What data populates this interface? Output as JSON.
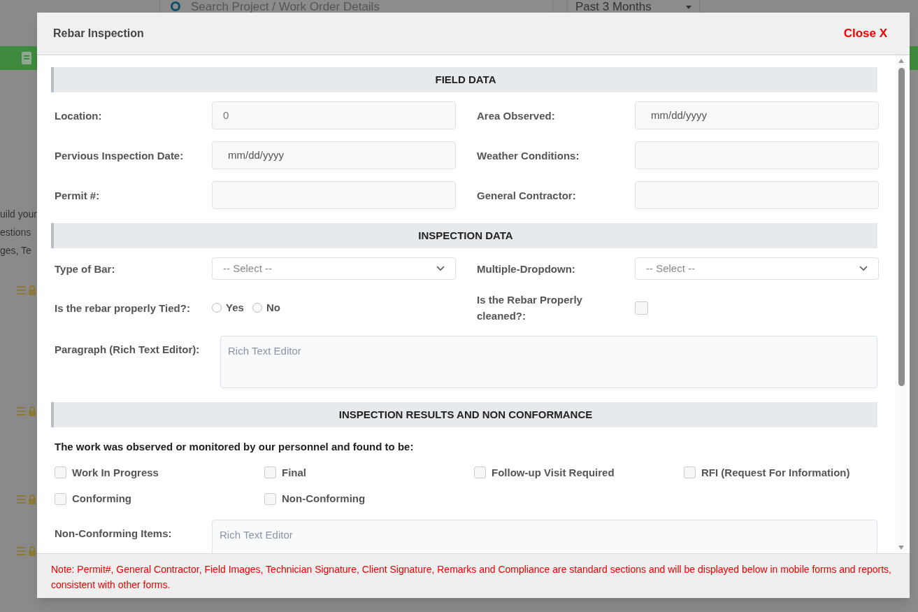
{
  "background": {
    "search_placeholder": "Search Project / Work Order Details",
    "period": "Past 3 Months",
    "sidebar_fragments": [
      "uild your",
      "estions",
      "ges, Te"
    ]
  },
  "modal": {
    "title": "Rebar Inspection",
    "close": "Close X",
    "sections": [
      {
        "title": "FIELD DATA",
        "rows": [
          [
            {
              "kind": "text",
              "label": "Location:",
              "value": "0"
            },
            {
              "kind": "date",
              "label": "Area Observed:",
              "placeholder": "mm/dd/yyyy"
            }
          ],
          [
            {
              "kind": "date",
              "label": "Pervious Inspection Date:",
              "placeholder": "mm/dd/yyyy"
            },
            {
              "kind": "text",
              "label": "Weather Conditions:"
            }
          ],
          [
            {
              "kind": "text",
              "label": "Permit #:"
            },
            {
              "kind": "text",
              "label": "General Contractor:"
            }
          ]
        ]
      },
      {
        "title": "INSPECTION DATA",
        "rows": [
          [
            {
              "kind": "select",
              "label": "Type of Bar:",
              "placeholder": "-- Select --"
            },
            {
              "kind": "select",
              "label": "Multiple-Dropdown:",
              "placeholder": "-- Select --"
            }
          ],
          [
            {
              "kind": "radio",
              "label": "Is the rebar properly Tied?:",
              "options": [
                {
                  "label": "Yes",
                  "selected": false
                },
                {
                  "label": "No",
                  "selected": false
                }
              ]
            },
            {
              "kind": "checkbox",
              "label": "Is the Rebar Properly cleaned?:",
              "checked": false
            }
          ],
          [
            {
              "kind": "richtext",
              "label": "Paragraph (Rich Text Editor):",
              "placeholder": "Rich Text Editor"
            }
          ]
        ]
      },
      {
        "title": "INSPECTION RESULTS AND NON CONFORMANCE",
        "statement": "The work was observed or monitored by our personnel and found to be:",
        "checks": [
          {
            "label": "Work In Progress",
            "checked": false
          },
          {
            "label": "Final",
            "checked": false
          },
          {
            "label": "Follow-up Visit Required",
            "checked": false
          },
          {
            "label": "RFI (Request For Information)",
            "checked": false
          },
          {
            "label": "Conforming",
            "checked": false
          },
          {
            "label": "Non-Conforming",
            "checked": false
          }
        ],
        "rows": [
          [
            {
              "kind": "richtext",
              "label": "Non-Conforming Items:",
              "placeholder": "Rich Text Editor"
            }
          ]
        ]
      }
    ],
    "note": "Note: Permit#, General Contractor, Field Images, Technician Signature, Client Signature, Remarks and Compliance are standard sections and will be displayed below in mobile forms and reports, consistent with other forms."
  }
}
